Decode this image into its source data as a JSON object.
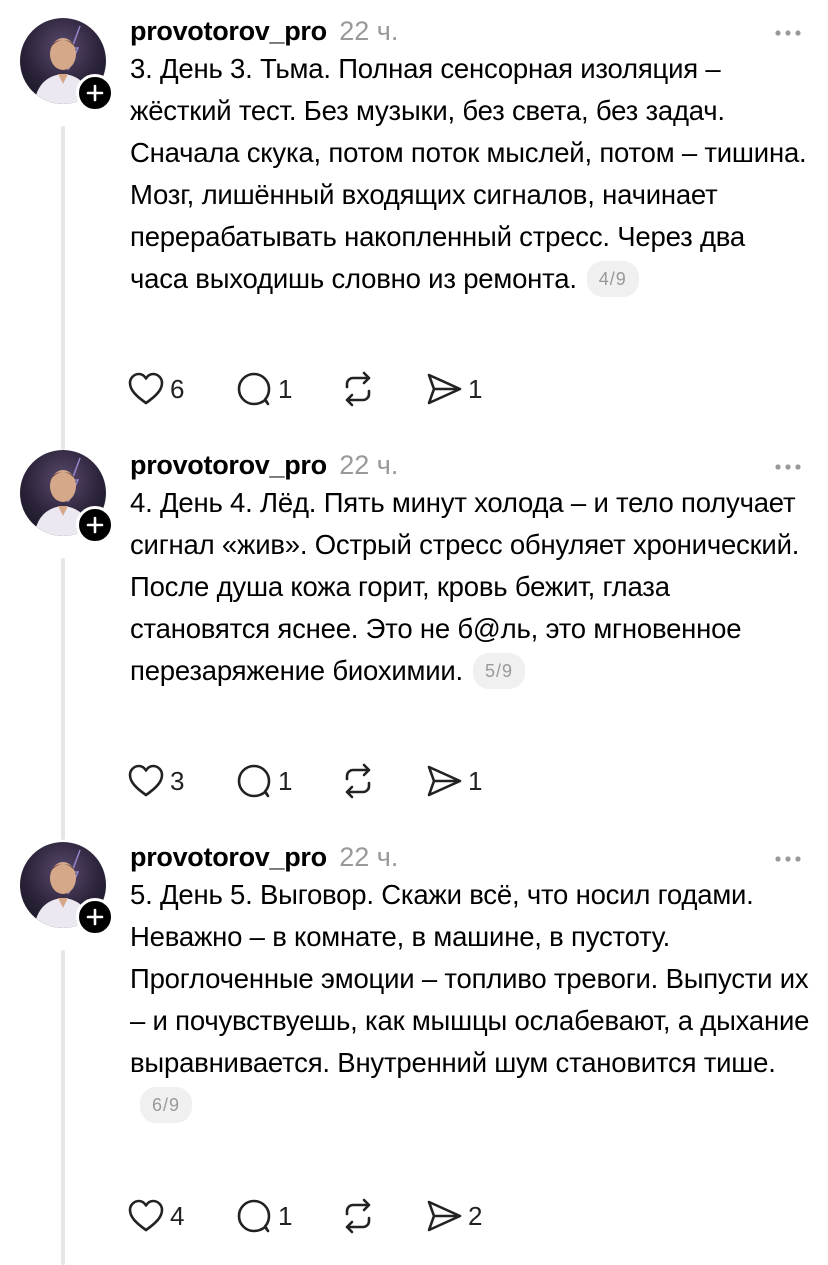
{
  "posts": [
    {
      "username": "provotorov_pro",
      "time": "22 ч.",
      "text": "3. День 3. Тьма. Полная сенсорная изоляция – жёсткий тест. Без музыки, без света, без задач. Сначала скука, потом поток мыслей, потом – тишина. Мозг, лишённый входящих сигналов, начинает перерабатывать накопленный стресс. Через два часа выходишь словно из ремонта.",
      "counter": "4/9",
      "likes": "6",
      "replies": "1",
      "reposts": "",
      "shares": "1"
    },
    {
      "username": "provotorov_pro",
      "time": "22 ч.",
      "text": "4. День 4. Лёд. Пять минут холода – и тело получает сигнал «жив». Острый стресс обнуляет хронический. После душа кожа горит, кровь бежит, глаза становятся яснее. Это не б@ль, это мгновенное перезаряжение биохимии.",
      "counter": "5/9",
      "likes": "3",
      "replies": "1",
      "reposts": "",
      "shares": "1"
    },
    {
      "username": "provotorov_pro",
      "time": "22 ч.",
      "text": "5. День 5. Выговор. Скажи всё, что носил годами. Неважно – в комнате, в машине, в пустоту. Проглоченные эмоции – топливо тревоги. Выпусти их – и почувствуешь, как мышцы ослабевают, а дыхание выравнивается. Внутренний шум становится тише.",
      "counter": "6/9",
      "likes": "4",
      "replies": "1",
      "reposts": "",
      "shares": "2"
    }
  ],
  "icons": {
    "like": "heart-icon",
    "reply": "comment-icon",
    "repost": "repost-icon",
    "share": "send-icon",
    "more": "more-icon",
    "follow": "plus-icon"
  },
  "colors": {
    "text": "#000000",
    "muted": "#999999",
    "counter_bg": "#f0f0f0",
    "thread_line": "#e6e6e6"
  }
}
